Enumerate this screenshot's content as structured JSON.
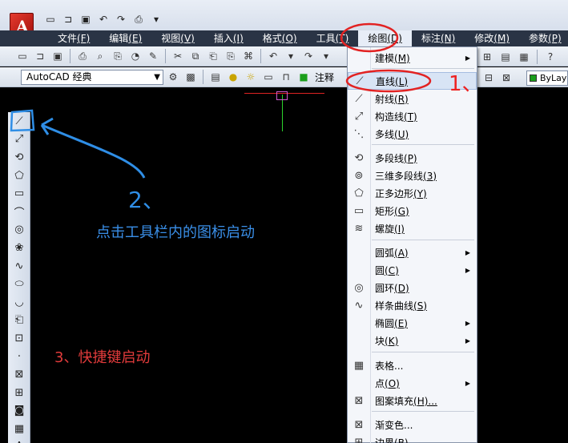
{
  "app": {
    "logo_letter": "A"
  },
  "menubar": {
    "items": [
      {
        "label": "文件",
        "key": "(F)"
      },
      {
        "label": "编辑",
        "key": "(E)"
      },
      {
        "label": "视图",
        "key": "(V)"
      },
      {
        "label": "插入",
        "key": "(I)"
      },
      {
        "label": "格式",
        "key": "(O)"
      },
      {
        "label": "工具",
        "key": "(T)"
      },
      {
        "label": "绘图",
        "key": "(D)"
      },
      {
        "label": "标注",
        "key": "(N)"
      },
      {
        "label": "修改",
        "key": "(M)"
      },
      {
        "label": "参数",
        "key": "(P)"
      }
    ]
  },
  "toolbar2": {
    "workspace": "AutoCAD 经典",
    "annotation_label": "注释",
    "bylayer": "ByLayer"
  },
  "draw_menu": {
    "items": [
      {
        "label": "建模",
        "key": "(M)",
        "submenu": true,
        "icon": "none"
      },
      {
        "label": "直线",
        "key": "(L)",
        "submenu": false,
        "icon": "line-icon"
      },
      {
        "label": "射线",
        "key": "(R)",
        "submenu": false,
        "icon": "ray-icon"
      },
      {
        "label": "构造线",
        "key": "(T)",
        "submenu": false,
        "icon": "xline-icon"
      },
      {
        "label": "多线",
        "key": "(U)",
        "submenu": false,
        "icon": "mline-icon"
      },
      {
        "label": "多段线",
        "key": "(P)",
        "submenu": false,
        "icon": "polyline-icon"
      },
      {
        "label": "三维多段线",
        "key": "(3)",
        "submenu": false,
        "icon": "3dpoly-icon"
      },
      {
        "label": "正多边形",
        "key": "(Y)",
        "submenu": false,
        "icon": "polygon-icon"
      },
      {
        "label": "矩形",
        "key": "(G)",
        "submenu": false,
        "icon": "rectangle-icon"
      },
      {
        "label": "螺旋",
        "key": "(I)",
        "submenu": false,
        "icon": "helix-icon"
      },
      {
        "label": "圆弧",
        "key": "(A)",
        "submenu": true,
        "icon": "none"
      },
      {
        "label": "圆",
        "key": "(C)",
        "submenu": true,
        "icon": "none"
      },
      {
        "label": "圆环",
        "key": "(D)",
        "submenu": false,
        "icon": "donut-icon"
      },
      {
        "label": "样条曲线",
        "key": "(S)",
        "submenu": false,
        "icon": "spline-icon"
      },
      {
        "label": "椭圆",
        "key": "(E)",
        "submenu": true,
        "icon": "none"
      },
      {
        "label": "块",
        "key": "(K)",
        "submenu": true,
        "icon": "none"
      },
      {
        "label": "表格...",
        "key": "",
        "submenu": false,
        "icon": "table-icon"
      },
      {
        "label": "点",
        "key": "(O)",
        "submenu": true,
        "icon": "none"
      },
      {
        "label": "图案填充",
        "key": "(H)...",
        "submenu": false,
        "icon": "hatch-icon"
      },
      {
        "label": "渐变色...",
        "key": "",
        "submenu": false,
        "icon": "gradient-icon"
      },
      {
        "label": "边界",
        "key": "(B)...",
        "submenu": false,
        "icon": "boundary-icon"
      }
    ]
  },
  "annotations": {
    "one": "1、",
    "two": "2、",
    "toolbar_hint": "点击工具栏内的图标启动",
    "shortcut_hint": "3、快捷键启动"
  },
  "colors": {
    "menubar_bg": "#2a3445",
    "annotation_red": "#e22222",
    "annotation_blue": "#2f8ee6"
  }
}
